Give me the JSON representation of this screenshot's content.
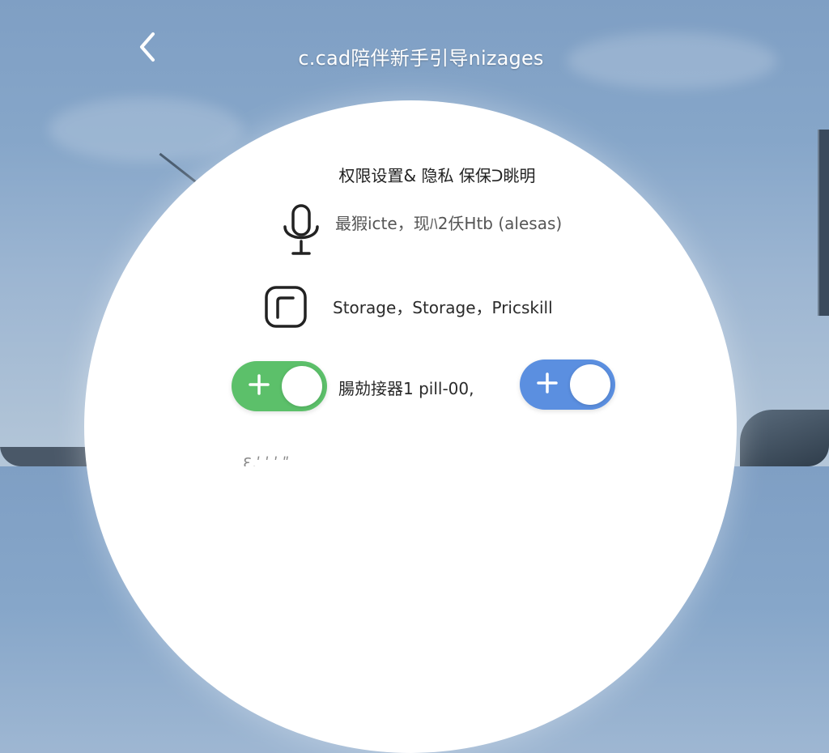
{
  "header": {
    "title": "c.cad陪伴新手引导nizages",
    "back_icon": "chevron-left-icon"
  },
  "card": {
    "title": "权限设置& 隐私 保保ᑐ眺明",
    "rows": [
      {
        "icon": "microphone-icon",
        "label": "最猳icte，现ﾊ2仸Htb (alesas)"
      },
      {
        "icon": "storage-icon",
        "label": "Storage，Storage，Pricskill"
      }
    ],
    "toggle_row": {
      "label": "腸勀接器1 pill-00,",
      "toggles": [
        {
          "state": "on",
          "color": "#5cc06a",
          "icon": "plus-icon"
        },
        {
          "state": "on",
          "color": "#5b8fe0",
          "icon": "plus-icon"
        }
      ]
    },
    "partial_text": "Ɛ,ʹ    ʹ    ʹ ʺ"
  },
  "colors": {
    "toggle_green": "#5cc06a",
    "toggle_blue": "#5b8fe0",
    "card_bg": "#ffffff"
  }
}
